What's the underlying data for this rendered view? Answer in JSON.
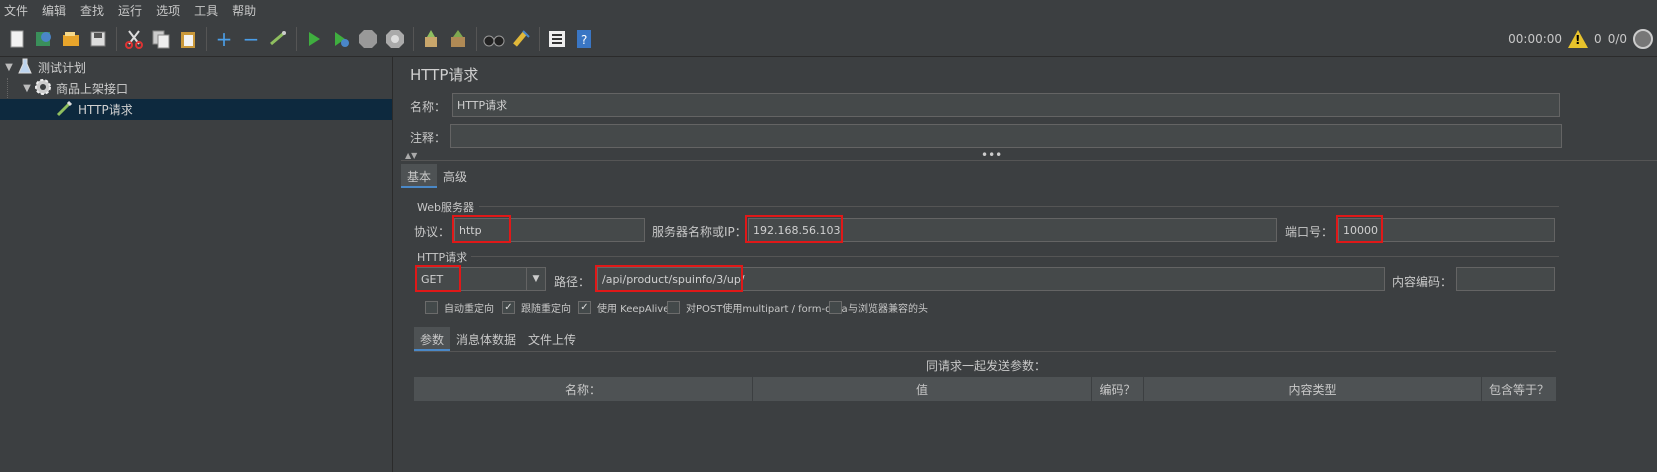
{
  "menu": [
    "文件",
    "编辑",
    "查找",
    "运行",
    "选项",
    "工具",
    "帮助"
  ],
  "toolbar": {
    "icons": [
      "new-icon",
      "templates-icon",
      "open-icon",
      "save-icon",
      "cut-icon",
      "copy-icon",
      "paste-icon",
      "expand-icon",
      "collapse-icon",
      "toggle-icon",
      "start-icon",
      "start-no-pause-icon",
      "stop-icon",
      "shutdown-icon",
      "clear-icon",
      "clear-all-icon",
      "search-icon",
      "reset-search-icon",
      "function-helper-icon",
      "help-icon"
    ],
    "timer": "00:00:00",
    "warnings": "0",
    "threads": "0/0"
  },
  "tree": {
    "items": [
      {
        "label": "测试计划",
        "icon": "flask-icon"
      },
      {
        "label": "商品上架接口",
        "icon": "gear-icon"
      },
      {
        "label": "HTTP请求",
        "icon": "pipette-icon"
      }
    ]
  },
  "panel": {
    "title": "HTTP请求",
    "name_label": "名称：",
    "name_value": "HTTP请求",
    "comment_label": "注释：",
    "comment_value": "",
    "tabs": [
      "基本",
      "高级"
    ],
    "web_server_title": "Web服务器",
    "protocol_label": "协议：",
    "protocol_value": "http",
    "server_label": "服务器名称或IP：",
    "server_value": "192.168.56.103",
    "port_label": "端口号：",
    "port_value": "10000",
    "http_request_title": "HTTP请求",
    "method_value": "GET",
    "path_label": "路径：",
    "path_value": "/api/product/spuinfo/3/up/",
    "encoding_label": "内容编码：",
    "encoding_value": "",
    "checkboxes": [
      {
        "label": "自动重定向",
        "checked": false
      },
      {
        "label": "跟随重定向",
        "checked": true
      },
      {
        "label": "使用 KeepAlive",
        "checked": true
      },
      {
        "label": "对POST使用multipart / form-data",
        "checked": false
      },
      {
        "label": "与浏览器兼容的头",
        "checked": false
      }
    ],
    "sub_tabs": [
      "参数",
      "消息体数据",
      "文件上传"
    ],
    "params_caption": "同请求一起发送参数：",
    "columns": [
      "名称：",
      "值",
      "编码？",
      "内容类型",
      "包含等于？"
    ]
  }
}
